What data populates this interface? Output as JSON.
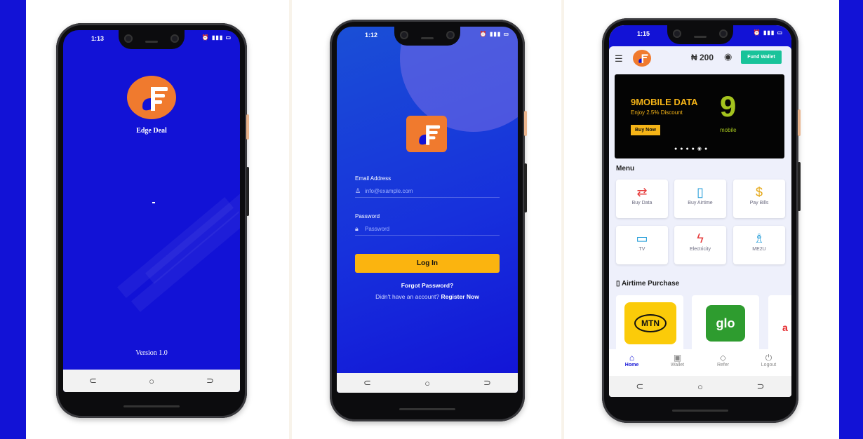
{
  "colors": {
    "brand_blue": "#1212d6",
    "accent_orange": "#f07a2e",
    "login_yellow": "#fbb40f",
    "fund_green": "#19c39a"
  },
  "splash": {
    "status_time": "1:13",
    "app_name": "Edge Deal",
    "version": "Version 1.0"
  },
  "login": {
    "status_time": "1:12",
    "email_label": "Email Address",
    "email_placeholder": "info@example.com",
    "password_label": "Password",
    "password_placeholder": "Password",
    "login_button": "Log In",
    "forgot_password": "Forgot Password?",
    "register_prompt": "Didn't have an account?",
    "register_link": "Register Now"
  },
  "home": {
    "status_time": "1:15",
    "balance": "₦ 200",
    "fund_wallet": "Fund Wallet",
    "banner": {
      "title": "9MOBILE DATA",
      "subtitle": "Enjoy 2.5% Discount",
      "cta": "Buy Now",
      "brand": "mobile"
    },
    "menu_title": "Menu",
    "menu_items": [
      {
        "label": "Buy Data",
        "icon": "swap-arrows-icon"
      },
      {
        "label": "Buy Airtime",
        "icon": "phone-icon"
      },
      {
        "label": "Pay Bills",
        "icon": "bills-icon"
      },
      {
        "label": "TV",
        "icon": "tv-icon"
      },
      {
        "label": "Electricity",
        "icon": "lightning-icon"
      },
      {
        "label": "ME2U",
        "icon": "me2u-icon"
      }
    ],
    "airtime_title": "Airtime Purchase",
    "networks": [
      "MTN",
      "glo"
    ],
    "bottom_nav": [
      "Home",
      "Wallet",
      "Refer",
      "Logout"
    ]
  }
}
